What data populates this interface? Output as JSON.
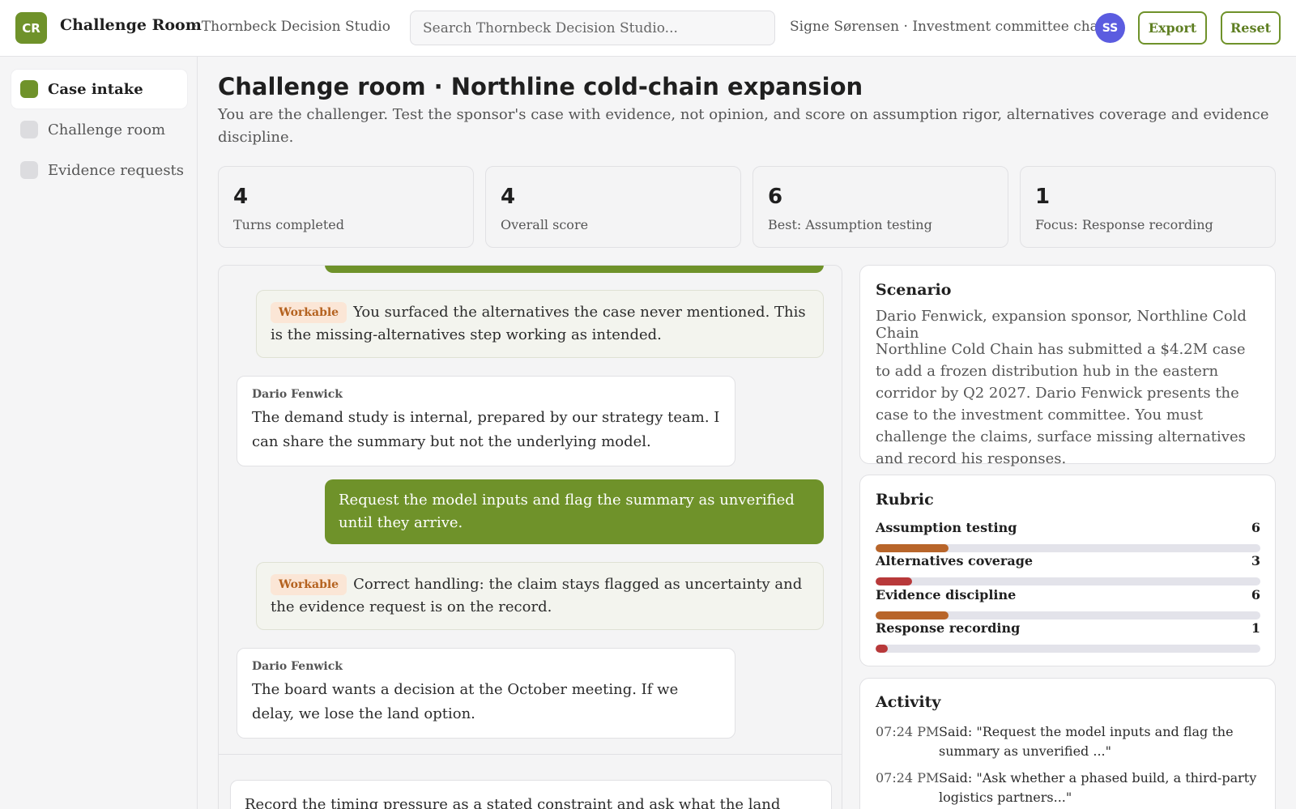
{
  "header": {
    "logo_initials": "CR",
    "app_title": "Challenge Room",
    "workspace": "· Thornbeck Decision Studio",
    "search_placeholder": "Search Thornbeck Decision Studio...",
    "user_label": "Signe Sørensen · Investment committee chair",
    "avatar_initials": "SS",
    "export_label": "Export",
    "reset_label": "Reset"
  },
  "sidebar": {
    "items": [
      {
        "label": "Case intake",
        "active": true
      },
      {
        "label": "Challenge room",
        "active": false
      },
      {
        "label": "Evidence requests",
        "active": false
      }
    ]
  },
  "main": {
    "title": "Challenge room · Northline cold-chain expansion",
    "subtitle": "You are the challenger. Test the sponsor's case with evidence, not opinion, and score on assumption rigor, alternatives coverage and evidence discipline."
  },
  "stats": [
    {
      "value": "4",
      "label": "Turns completed"
    },
    {
      "value": "4",
      "label": "Overall score"
    },
    {
      "value": "6",
      "label": "Best: Assumption testing"
    },
    {
      "value": "1",
      "label": "Focus: Response recording"
    }
  ],
  "conversation": {
    "feedback_1": {
      "badge": "Workable",
      "text": "You surfaced the alternatives the case never mentioned. This is the missing-alternatives step working as intended."
    },
    "sponsor_1": {
      "name": "Dario Fenwick",
      "text": "The demand study is internal, prepared by our strategy team. I can share the summary but not the underlying model."
    },
    "user_1": {
      "text": "Request the model inputs and flag the summary as unverified until they arrive."
    },
    "feedback_2": {
      "badge": "Workable",
      "text": "Correct handling: the claim stays flagged as uncertainty and the evidence request is on the record."
    },
    "sponsor_2": {
      "name": "Dario Fenwick",
      "text": "The board wants a decision at the October meeting. If we delay, we lose the land option."
    },
    "composer_text": "Record the timing pressure as a stated constraint and ask what the land option"
  },
  "scenario": {
    "title": "Scenario",
    "who": "Dario Fenwick, expansion sponsor, Northline Cold Chain",
    "body": "Northline Cold Chain has submitted a $4.2M case to add a frozen distribution hub in the eastern corridor by Q2 2027. Dario Fenwick presents the case to the investment committee. You must challenge the claims, surface missing alternatives and record his responses."
  },
  "rubric": {
    "title": "Rubric",
    "max": 10,
    "items": [
      {
        "label": "Assumption testing",
        "score": "6",
        "value": 6,
        "color": "#b8652a"
      },
      {
        "label": "Alternatives coverage",
        "score": "3",
        "value": 3,
        "color": "#b8393a"
      },
      {
        "label": "Evidence discipline",
        "score": "6",
        "value": 6,
        "color": "#b8652a"
      },
      {
        "label": "Response recording",
        "score": "1",
        "value": 1,
        "color": "#b8393a"
      }
    ]
  },
  "activity": {
    "title": "Activity",
    "items": [
      {
        "time": "07:24 PM",
        "text": "Said: \"Request the model inputs and flag the summary as unverified ...\""
      },
      {
        "time": "07:24 PM",
        "text": "Said: \"Ask whether a phased build, a third-party logistics partners...\""
      }
    ]
  }
}
